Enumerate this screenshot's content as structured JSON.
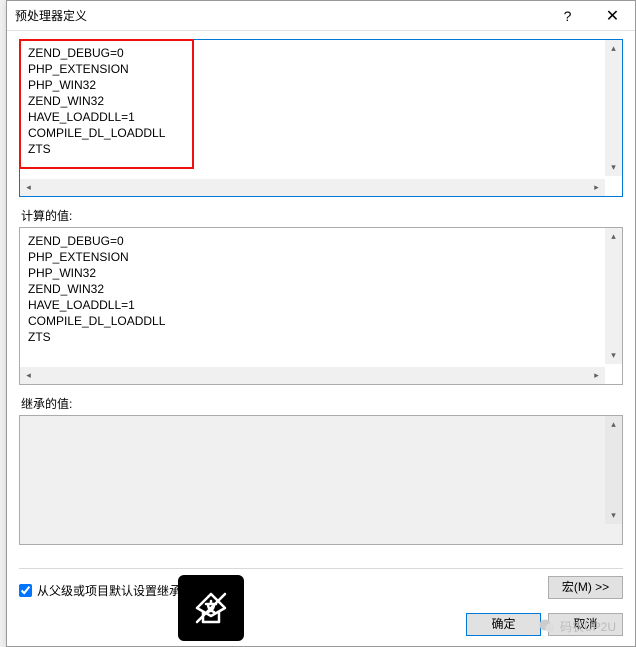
{
  "title": "预处理器定义",
  "editable_values": "ZEND_DEBUG=0\nPHP_EXTENSION\nPHP_WIN32\nZEND_WIN32\nHAVE_LOADDLL=1\nCOMPILE_DL_LOADDLL\nZTS",
  "sections": {
    "computed_label": "计算的值:",
    "computed_values": "ZEND_DEBUG=0\nPHP_EXTENSION\nPHP_WIN32\nZEND_WIN32\nHAVE_LOADDLL=1\nCOMPILE_DL_LOADDLL\nZTS",
    "inherited_label": "继承的值:"
  },
  "checkbox": {
    "label_prefix": "从父级或项目默认设置继承",
    "checked": true
  },
  "buttons": {
    "macro": "宏(M) >>",
    "ok": "确定",
    "cancel": "取消",
    "help": "?",
    "close": "✕"
  },
  "watermark": "码农UP2U",
  "glyphs": {
    "up": "▴",
    "down": "▾",
    "left": "◂",
    "right": "▸"
  }
}
